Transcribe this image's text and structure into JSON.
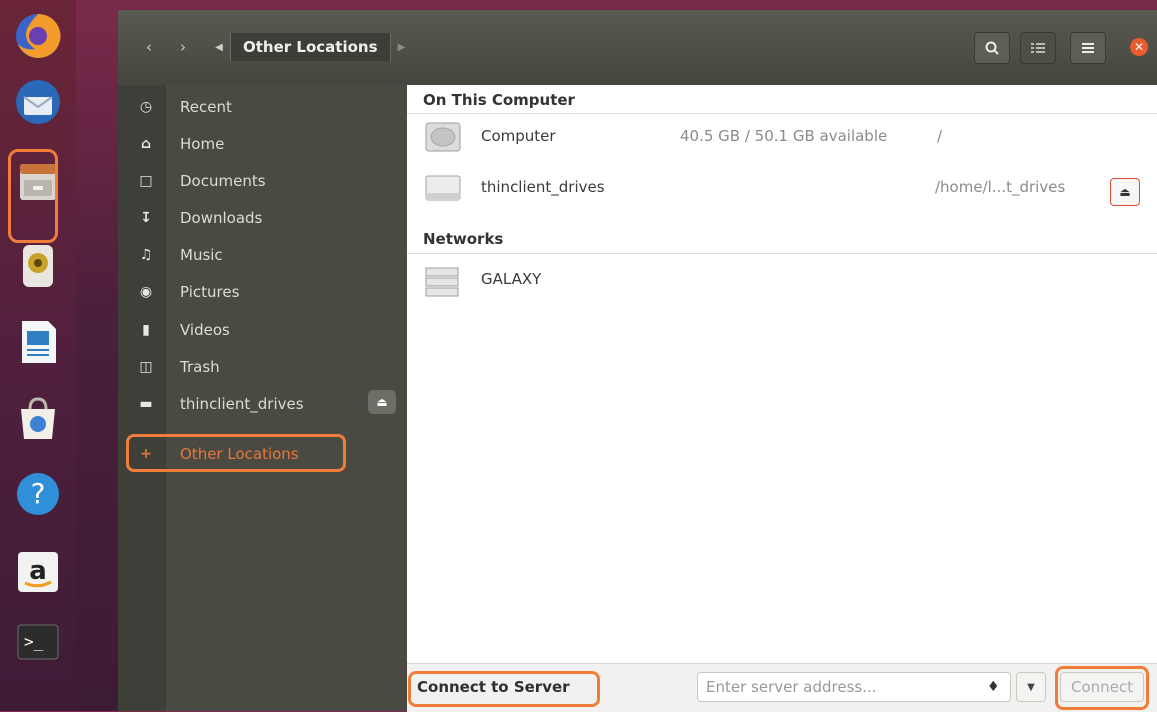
{
  "window": {
    "location": "Other Locations"
  },
  "sidebar": {
    "items": [
      {
        "label": "Recent",
        "icon": "clock-icon"
      },
      {
        "label": "Home",
        "icon": "home-icon"
      },
      {
        "label": "Documents",
        "icon": "document-icon"
      },
      {
        "label": "Downloads",
        "icon": "download-icon"
      },
      {
        "label": "Music",
        "icon": "music-icon"
      },
      {
        "label": "Pictures",
        "icon": "camera-icon"
      },
      {
        "label": "Videos",
        "icon": "video-icon"
      },
      {
        "label": "Trash",
        "icon": "trash-icon"
      },
      {
        "label": "thinclient_drives",
        "icon": "drive-icon"
      },
      {
        "label": "Other Locations",
        "icon": "plus-icon"
      }
    ]
  },
  "main": {
    "on_this_computer": "On This Computer",
    "computer": {
      "name": "Computer",
      "usage": "40.5 GB / 50.1 GB available",
      "mount": "/"
    },
    "thinclient": {
      "name": "thinclient_drives",
      "path": "/home/l...t_drives"
    },
    "networks": "Networks",
    "galaxy": {
      "name": "GALAXY"
    }
  },
  "footer": {
    "connect_label": "Connect to Server",
    "server_placeholder": "Enter server address...",
    "connect_button": "Connect"
  },
  "colors": {
    "accent_orange": "#f07d3a",
    "sidebar_bg": "#4a4a43",
    "header_bg": "#46463f"
  }
}
